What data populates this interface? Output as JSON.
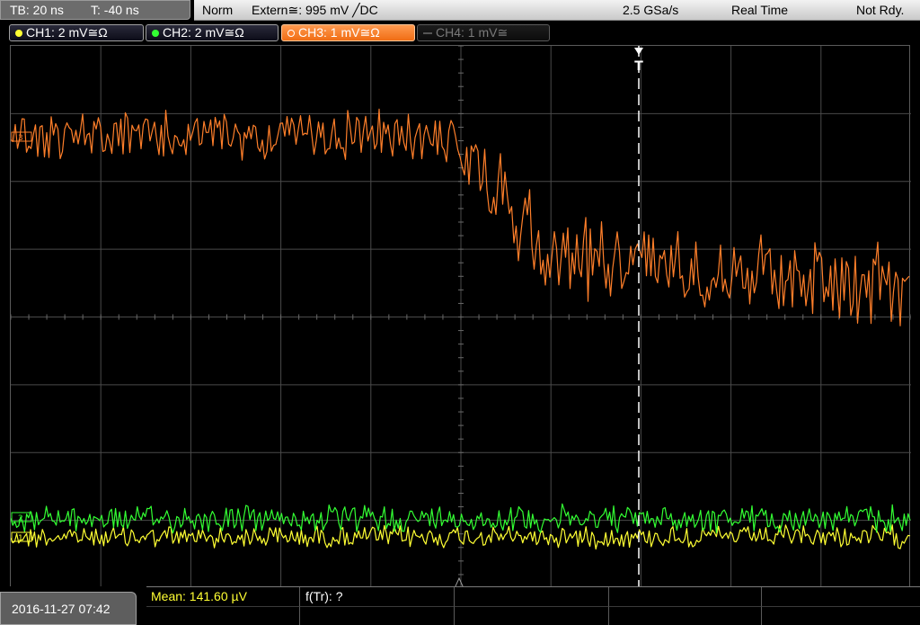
{
  "timebase": {
    "tb": "TB: 20 ns",
    "trig_pos": "T: -40 ns"
  },
  "status": {
    "mode": "Norm",
    "trigger": "Extern≅: 995 mV ╱DC",
    "sample_rate": "2.5 GSa/s",
    "acq_mode": "Real Time",
    "state": "Not Rdy."
  },
  "channels": [
    {
      "label": "CH1: 2 mV≅Ω",
      "color": "#ffff33",
      "active": false,
      "enabled": true
    },
    {
      "label": "CH2: 2 mV≅Ω",
      "color": "#33ff33",
      "active": false,
      "enabled": true
    },
    {
      "label": "CH3: 1 mV≅Ω",
      "color": "#ff7f2a",
      "active": true,
      "enabled": true
    },
    {
      "label": "CH4: 1 mV≅",
      "color": "#7a7a7a",
      "active": false,
      "enabled": false
    }
  ],
  "trigger_marker": {
    "label": "T"
  },
  "ground_markers": {
    "ch3": "3",
    "ch1": "1",
    "ch2": "2"
  },
  "datetime": "2016-11-27 07:42",
  "measurements": [
    {
      "label": "Mean: 141.60 µV",
      "color": "#ffff33"
    },
    {
      "label": "f(Tr): ?",
      "color": "#ffffff"
    }
  ],
  "colors": {
    "grid": "#4a4a4a",
    "trigger_line": "#ffffff",
    "ch1": "#ffff33",
    "ch2": "#33ff33",
    "ch3": "#ff7f2a"
  }
}
